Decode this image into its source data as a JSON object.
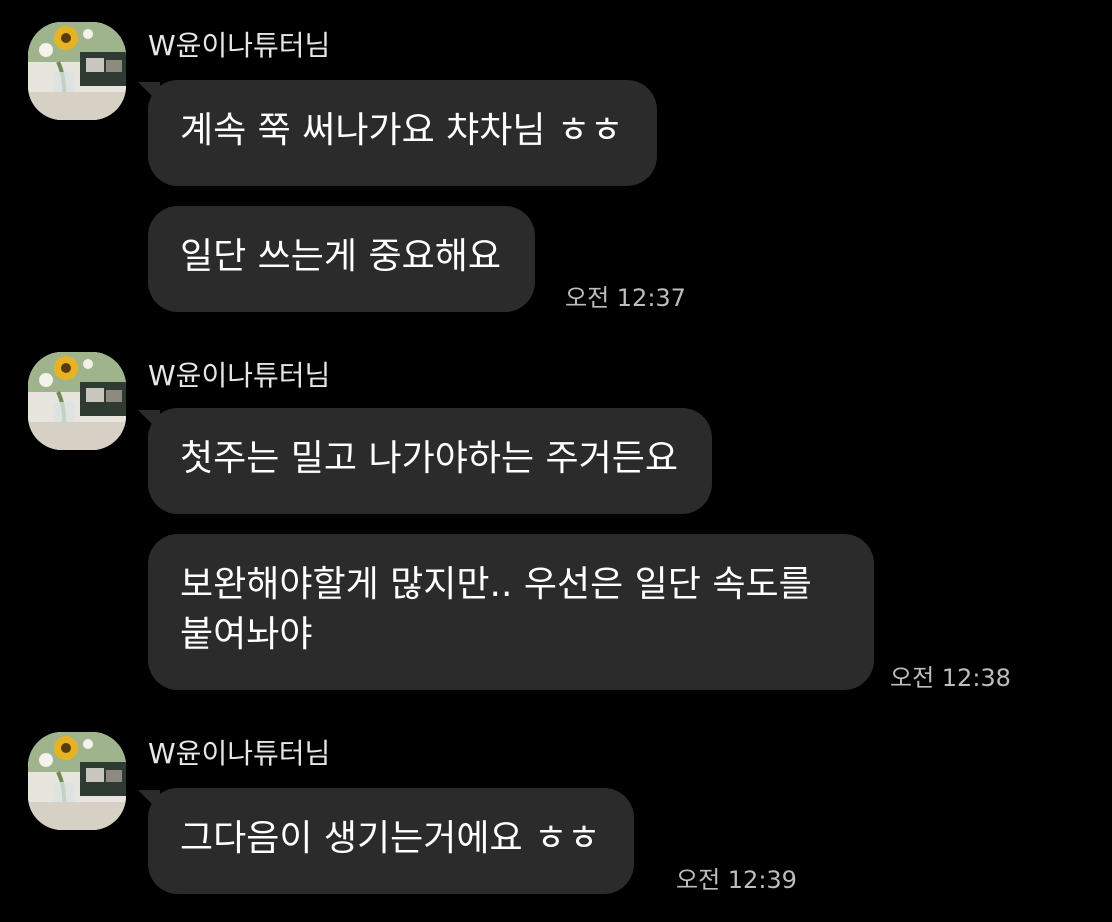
{
  "groups": [
    {
      "sender": "W윤이나튜터님",
      "messages": [
        "계속 쭉 써나가요 챠차님 ㅎㅎ",
        "일단 쓰는게 중요해요"
      ],
      "time": "오전 12:37"
    },
    {
      "sender": "W윤이나튜터님",
      "messages": [
        "첫주는 밀고 나가야하는 주거든요",
        "보완해야할게 많지만.. 우선은 일단 속도를 붙여놔야"
      ],
      "time": "오전 12:38"
    },
    {
      "sender": "W윤이나튜터님",
      "messages": [
        "그다음이 생기는거에요 ㅎㅎ"
      ],
      "time": "오전 12:39"
    }
  ],
  "colors": {
    "background": "#000000",
    "bubble": "#2b2b2b",
    "text": "#ffffff",
    "sender": "#e6e6e6",
    "time": "#bdbdbd"
  }
}
